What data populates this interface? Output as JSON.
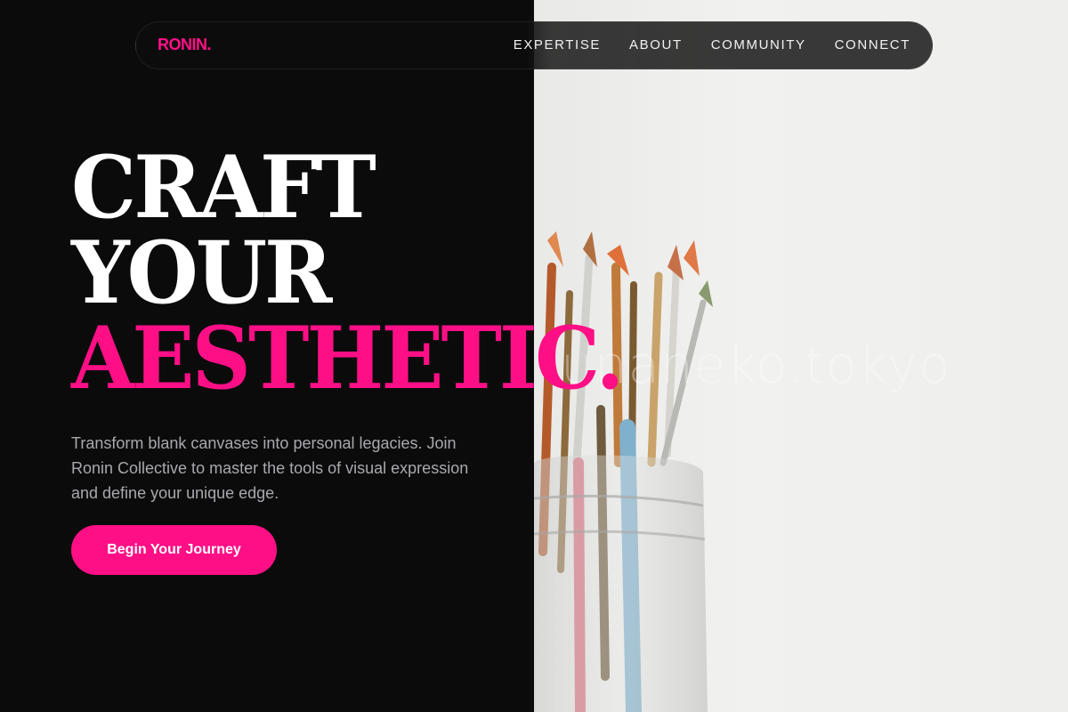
{
  "brand": {
    "logo": "RONIN."
  },
  "nav": {
    "items": [
      "EXPERTISE",
      "ABOUT",
      "COMMUNITY",
      "CONNECT"
    ]
  },
  "hero": {
    "line1": "CRAFT",
    "line2": "YOUR",
    "line3": "AESTHETIC.",
    "description": "Transform blank canvases into personal legacies. Join Ronin Collective to master the tools of visual expression and define your unique edge.",
    "cta": "Begin Your Journey"
  },
  "image": {
    "watermark": "unaneko.tokyo"
  },
  "colors": {
    "accent": "#ff0f86",
    "background": "#0b0b0c",
    "text": "#ffffff",
    "muted": "#a9a9ad"
  }
}
